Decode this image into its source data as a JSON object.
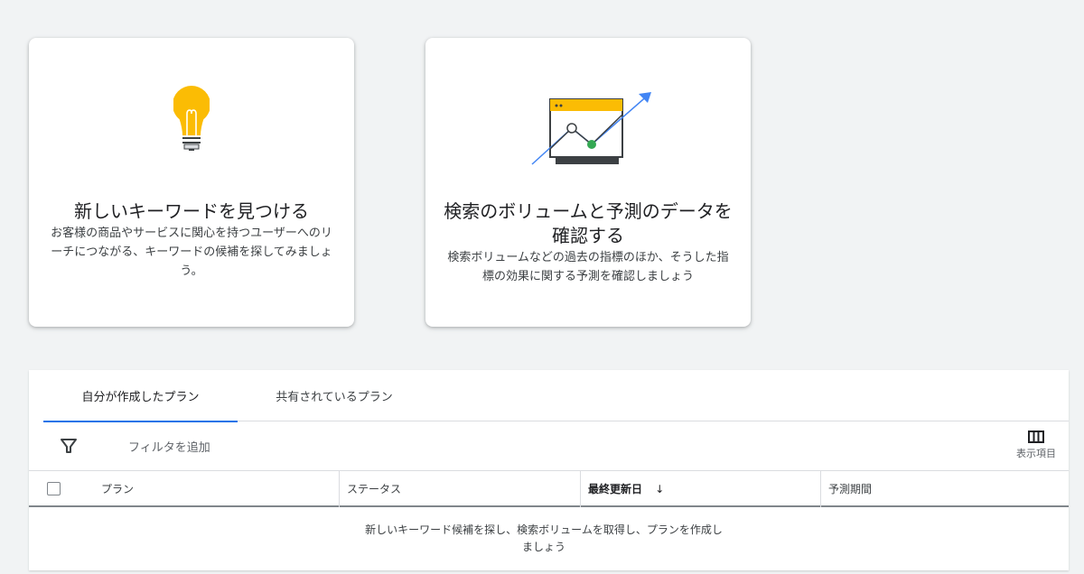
{
  "cards": [
    {
      "title": "新しいキーワードを見つける",
      "description": "お客様の商品やサービスに関心を持つユーザーへのリーチにつながる、キーワードの候補を探してみましょう。",
      "icon": "lightbulb-icon"
    },
    {
      "title": "検索のボリュームと予測のデータを確認する",
      "description": "検索ボリュームなどの過去の指標のほか、そうした指標の効果に関する予測を確認しましょう",
      "icon": "trend-chart-icon"
    }
  ],
  "tabs": [
    {
      "label": "自分が作成したプラン",
      "active": true
    },
    {
      "label": "共有されているプラン",
      "active": false
    }
  ],
  "filter": {
    "label": "フィルタを追加",
    "icon": "filter-icon"
  },
  "columns_button": {
    "label": "表示項目",
    "icon": "columns-icon"
  },
  "table": {
    "headers": [
      "プラン",
      "ステータス",
      "最終更新日",
      "予測期間"
    ],
    "sort_indicator": "↓",
    "empty_message": "新しいキーワード候補を探し、検索ボリュームを取得し、プランを作成しましょう"
  },
  "colors": {
    "accent": "#1a73e8",
    "bulb": "#fbbc04",
    "chart_line": "#4285f4",
    "point_green": "#34a853"
  }
}
